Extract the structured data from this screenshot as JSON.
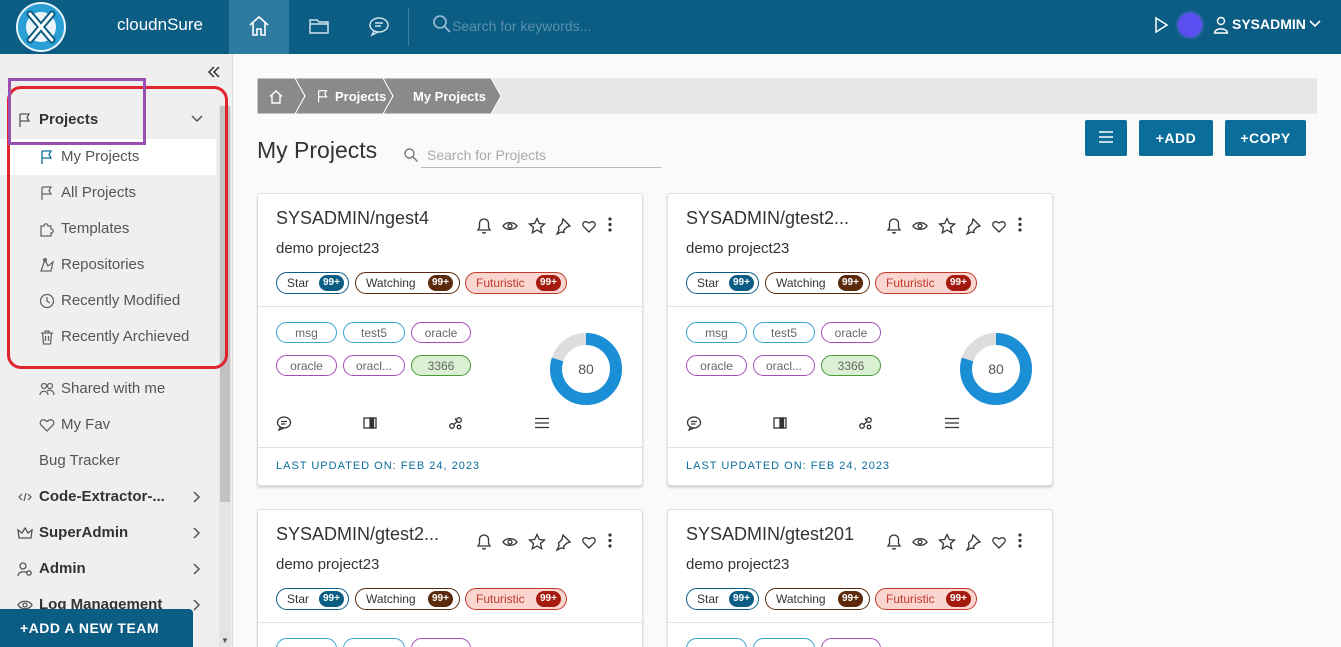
{
  "app": {
    "name": "cloudnSure"
  },
  "topbar": {
    "search_placeholder": "Search for keywords...",
    "user": "SYSADMIN",
    "icons": [
      "home-icon",
      "folder-icon",
      "chat-icon",
      "search-icon",
      "play-icon",
      "avatar",
      "user-icon",
      "chevron-down-icon"
    ]
  },
  "sidebar": {
    "projects": {
      "label": "Projects",
      "items": [
        {
          "label": "My Projects",
          "icon": "flag-icon"
        },
        {
          "label": "All Projects",
          "icon": "flag-icon"
        },
        {
          "label": "Templates",
          "icon": "puzzle-icon"
        },
        {
          "label": "Repositories",
          "icon": "repo-icon"
        },
        {
          "label": "Recently Modified",
          "icon": "clock-icon"
        },
        {
          "label": "Recently Archieved",
          "icon": "trash-icon"
        }
      ]
    },
    "extra_items": [
      {
        "label": "Shared with me",
        "icon": "users-icon"
      },
      {
        "label": "My Fav",
        "icon": "heart-icon"
      },
      {
        "label": "Bug Tracker",
        "icon": ""
      }
    ],
    "sections": [
      {
        "label": "Code-Extractor-...",
        "icon": "code-icon"
      },
      {
        "label": "SuperAdmin",
        "icon": "crown-icon"
      },
      {
        "label": "Admin",
        "icon": "admin-icon"
      },
      {
        "label": "Log Management",
        "icon": "eye-icon"
      }
    ],
    "add_team_button": "+ADD A NEW TEAM"
  },
  "breadcrumb": {
    "items": [
      "Projects",
      "My Projects"
    ]
  },
  "main": {
    "title": "My Projects",
    "search_placeholder": "Search for Projects",
    "buttons": {
      "add": "+ADD",
      "copy": "+COPY"
    }
  },
  "colors": {
    "brand": "#0b5d84",
    "button": "#0b6d99",
    "highlight_red": "#e0252e",
    "highlight_purple": "#9b4fb0"
  },
  "cards": [
    {
      "title": "SYSADMIN/ngest4",
      "desc": "demo project23",
      "badges": {
        "star": "Star",
        "star_count": "99+",
        "watching": "Watching",
        "watching_count": "99+",
        "futuristic": "Futuristic",
        "futuristic_count": "99+"
      },
      "tags": [
        "msg",
        "test5",
        "oracle",
        "oracle",
        "oracl...",
        "3366"
      ],
      "progress": 80,
      "updated": "LAST UPDATED ON: FEB 24, 2023"
    },
    {
      "title": "SYSADMIN/gtest2...",
      "desc": "demo project23",
      "badges": {
        "star": "Star",
        "star_count": "99+",
        "watching": "Watching",
        "watching_count": "99+",
        "futuristic": "Futuristic",
        "futuristic_count": "99+"
      },
      "tags": [
        "msg",
        "test5",
        "oracle",
        "oracle",
        "oracl...",
        "3366"
      ],
      "progress": 80,
      "updated": "LAST UPDATED ON: FEB 24, 2023"
    },
    {
      "title": "SYSADMIN/gtest2...",
      "desc": "demo project23",
      "badges": {
        "star": "Star",
        "star_count": "99+",
        "watching": "Watching",
        "watching_count": "99+",
        "futuristic": "Futuristic",
        "futuristic_count": "99+"
      }
    },
    {
      "title": "SYSADMIN/gtest201",
      "desc": "demo project23",
      "badges": {
        "star": "Star",
        "star_count": "99+",
        "watching": "Watching",
        "watching_count": "99+",
        "futuristic": "Futuristic",
        "futuristic_count": "99+"
      }
    }
  ]
}
